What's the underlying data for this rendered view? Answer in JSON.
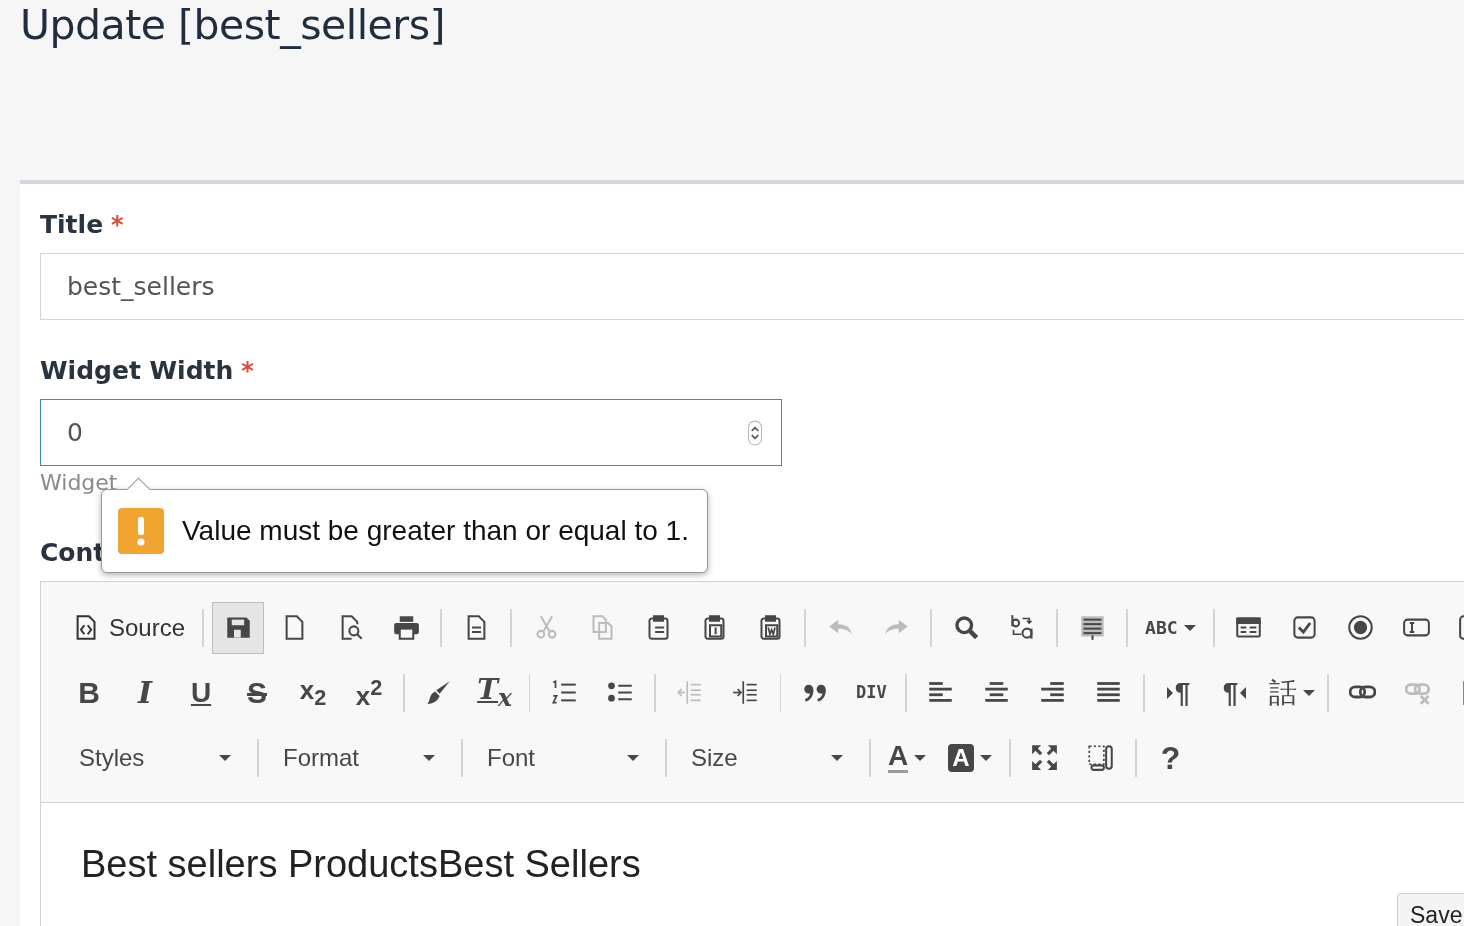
{
  "page_title": "Update [best_sellers]",
  "form": {
    "title": {
      "label": "Title",
      "required_mark": "*",
      "value": "best_sellers"
    },
    "widget_width": {
      "label": "Widget Width",
      "required_mark": "*",
      "value": "0",
      "focused": true,
      "hint": "Widget"
    },
    "content": {
      "label": "Cont"
    }
  },
  "validation_tooltip": {
    "message": "Value must be greater than or equal to 1."
  },
  "editor": {
    "toolbar": [
      [
        {
          "kind": "labeled",
          "label": "Source",
          "disabled": false,
          "pressed": false
        },
        {
          "kind": "separator"
        },
        {
          "kind": "icon",
          "disabled": false,
          "pressed": true
        },
        {
          "kind": "icon",
          "disabled": false,
          "pressed": false
        },
        {
          "kind": "icon",
          "disabled": false,
          "pressed": false
        },
        {
          "kind": "icon",
          "disabled": false,
          "pressed": false
        },
        {
          "kind": "separator"
        },
        {
          "kind": "icon",
          "disabled": false,
          "pressed": false
        },
        {
          "kind": "separator"
        },
        {
          "kind": "icon",
          "disabled": true,
          "pressed": false
        },
        {
          "kind": "icon",
          "disabled": true,
          "pressed": false
        },
        {
          "kind": "icon",
          "disabled": false,
          "pressed": false
        },
        {
          "kind": "icon",
          "disabled": false,
          "pressed": false
        },
        {
          "kind": "icon",
          "disabled": false,
          "pressed": false
        },
        {
          "kind": "separator"
        },
        {
          "kind": "icon",
          "disabled": true,
          "pressed": false
        },
        {
          "kind": "icon",
          "disabled": true,
          "pressed": false
        },
        {
          "kind": "separator"
        },
        {
          "kind": "icon",
          "disabled": false,
          "pressed": false
        },
        {
          "kind": "icon",
          "disabled": false,
          "pressed": false
        },
        {
          "kind": "separator"
        },
        {
          "kind": "icon",
          "disabled": false,
          "pressed": false
        },
        {
          "kind": "separator"
        },
        {
          "kind": "spellcheck",
          "label": "ABC",
          "disabled": false,
          "pressed": false
        },
        {
          "kind": "separator"
        },
        {
          "kind": "icon",
          "disabled": false,
          "pressed": false
        },
        {
          "kind": "icon",
          "disabled": false,
          "pressed": false
        },
        {
          "kind": "icon",
          "disabled": false,
          "pressed": false
        },
        {
          "kind": "icon",
          "disabled": false,
          "pressed": false
        },
        {
          "kind": "icon",
          "disabled": false,
          "pressed": false
        }
      ],
      [
        {
          "kind": "bold",
          "label": "B",
          "disabled": false,
          "pressed": false
        },
        {
          "kind": "italic",
          "label": "I",
          "disabled": false,
          "pressed": false
        },
        {
          "kind": "underline",
          "label": "U",
          "disabled": false,
          "pressed": false
        },
        {
          "kind": "strike",
          "label": "S",
          "disabled": false,
          "pressed": false
        },
        {
          "kind": "script",
          "label": "x$_{2}$",
          "disabled": false,
          "pressed": false
        },
        {
          "kind": "script",
          "label": "x$^{2}$",
          "disabled": false,
          "pressed": false
        },
        {
          "kind": "separator"
        },
        {
          "kind": "icon",
          "disabled": false,
          "pressed": false
        },
        {
          "kind": "clearformat",
          "label": "T$_{x}$",
          "disabled": false,
          "pressed": false
        },
        {
          "kind": "separator"
        },
        {
          "kind": "icon",
          "disabled": false,
          "pressed": false
        },
        {
          "kind": "icon",
          "disabled": false,
          "pressed": false
        },
        {
          "kind": "separator"
        },
        {
          "kind": "icon",
          "disabled": true,
          "pressed": false
        },
        {
          "kind": "icon",
          "disabled": false,
          "pressed": false
        },
        {
          "kind": "separator"
        },
        {
          "kind": "icon",
          "disabled": false,
          "pressed": false
        },
        {
          "kind": "div",
          "label": "DIV",
          "disabled": false,
          "pressed": false
        },
        {
          "kind": "separator"
        },
        {
          "kind": "icon",
          "disabled": false,
          "pressed": false
        },
        {
          "kind": "icon",
          "disabled": false,
          "pressed": false
        },
        {
          "kind": "icon",
          "disabled": false,
          "pressed": false
        },
        {
          "kind": "icon",
          "disabled": false,
          "pressed": false
        },
        {
          "kind": "separator"
        },
        {
          "kind": "ltr",
          "label": "¶",
          "disabled": false,
          "pressed": false
        },
        {
          "kind": "rtl",
          "label": "¶",
          "disabled": false,
          "pressed": false
        },
        {
          "kind": "language",
          "label": "話",
          "disabled": false,
          "pressed": false
        },
        {
          "kind": "separator"
        },
        {
          "kind": "icon",
          "disabled": false,
          "pressed": false
        },
        {
          "kind": "icon",
          "disabled": true,
          "pressed": false
        },
        {
          "kind": "icon",
          "disabled": false,
          "pressed": false
        }
      ],
      [
        {
          "kind": "combo",
          "label": "Styles",
          "disabled": false,
          "pressed": false
        },
        {
          "kind": "separator"
        },
        {
          "kind": "combo",
          "label": "Format",
          "disabled": false,
          "pressed": false
        },
        {
          "kind": "separator"
        },
        {
          "kind": "combo",
          "label": "Font",
          "disabled": false,
          "pressed": false
        },
        {
          "kind": "separator"
        },
        {
          "kind": "combo",
          "label": "Size",
          "disabled": false,
          "pressed": false
        },
        {
          "kind": "separator"
        },
        {
          "kind": "textcolor",
          "label": "A",
          "disabled": false,
          "pressed": false
        },
        {
          "kind": "bgcolor",
          "label": "A",
          "disabled": false,
          "pressed": false
        },
        {
          "kind": "separator"
        },
        {
          "kind": "icon",
          "disabled": false,
          "pressed": false
        },
        {
          "kind": "icon",
          "disabled": false,
          "pressed": false
        },
        {
          "kind": "separator"
        },
        {
          "kind": "help",
          "label": "?",
          "disabled": false,
          "pressed": false
        }
      ]
    ],
    "body": "Best sellers ProductsBest Sellers"
  },
  "save_button": "Save"
}
